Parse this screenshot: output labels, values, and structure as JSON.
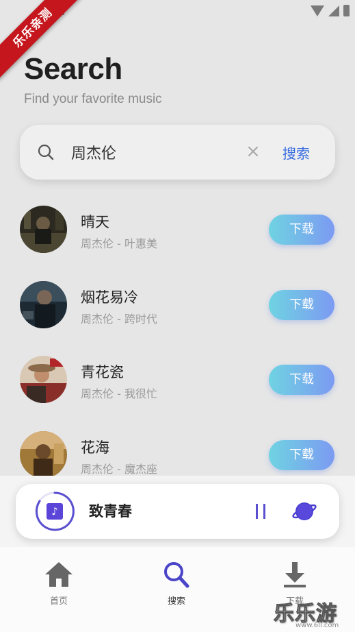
{
  "ribbon": {
    "text": "乐乐亲测"
  },
  "header": {
    "title": "Search",
    "subtitle": "Find your favorite music"
  },
  "search": {
    "value": "周杰伦",
    "clear_symbol": "×",
    "button_label": "搜索"
  },
  "songs": [
    {
      "title": "晴天",
      "subtitle": "周杰伦 - 叶惠美",
      "button": "下载"
    },
    {
      "title": "烟花易冷",
      "subtitle": "周杰伦 - 跨时代",
      "button": "下载"
    },
    {
      "title": "青花瓷",
      "subtitle": "周杰伦 - 我很忙",
      "button": "下载"
    },
    {
      "title": "花海",
      "subtitle": "周杰伦 - 魔杰座",
      "button": "下载"
    }
  ],
  "player": {
    "title": "致青春",
    "note_symbol": "♪"
  },
  "nav": {
    "home": "首页",
    "search": "搜索",
    "download": "下载"
  },
  "watermark": {
    "text": "乐乐游戏",
    "url": "www.6ll.com"
  },
  "colors": {
    "accent": "#3a6fe0",
    "player_accent": "#5a4fd0",
    "ribbon": "#c4161c"
  }
}
